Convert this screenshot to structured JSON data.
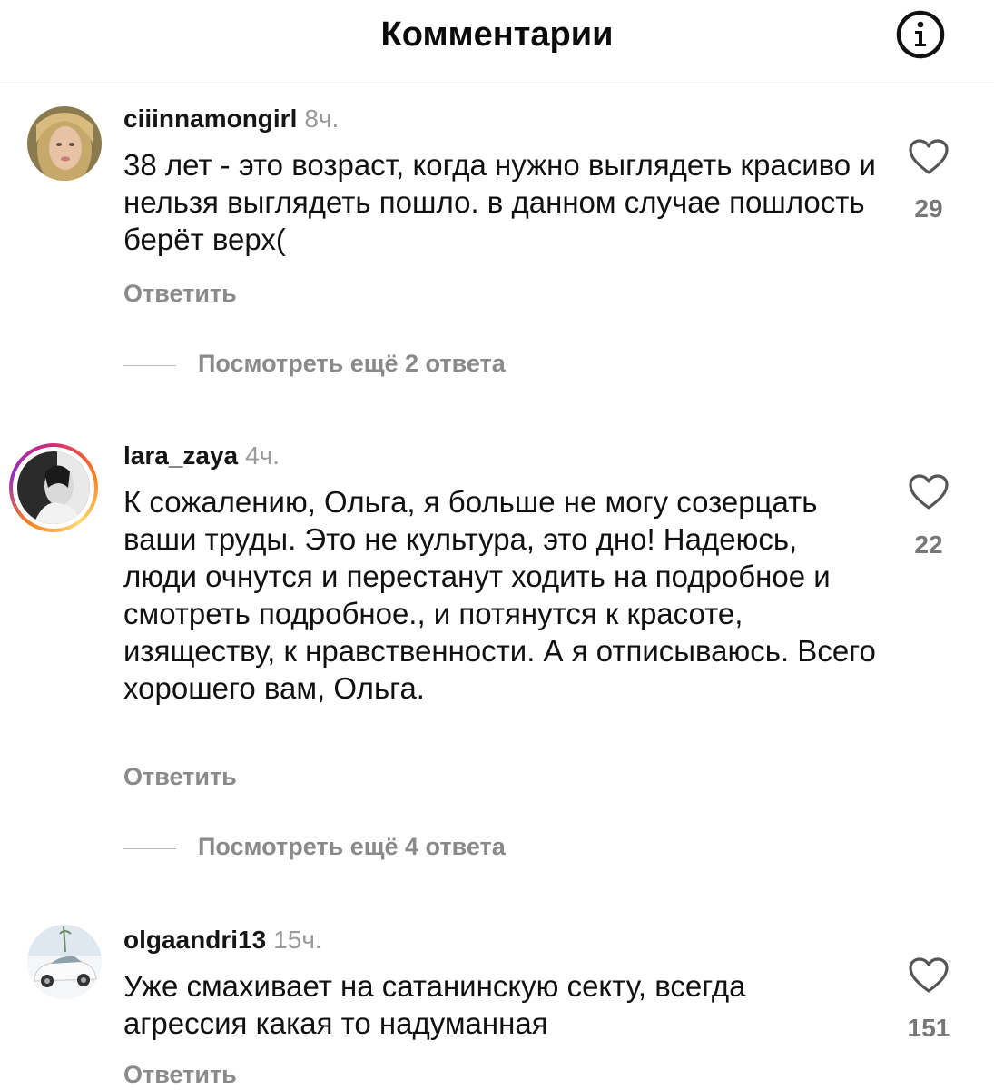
{
  "header": {
    "title": "Комментарии",
    "info_icon": "info-icon"
  },
  "comments": [
    {
      "username": "ciiinnamongirl",
      "time": "8ч.",
      "text": "38 лет - это возраст, когда нужно выглядеть красиво и нельзя выглядеть пошло. в данном случае пошлость берёт верх(",
      "reply_label": "Ответить",
      "likes": "29",
      "view_replies": "Посмотреть ещё 2 ответа",
      "has_story_ring": false
    },
    {
      "username": "lara_zaya",
      "time": "4ч.",
      "text": "К сожалению, Ольга, я больше не могу созерцать ваши труды. Это не культура, это дно! Надеюсь, люди очнутся и перестанут ходить на подробное и смотреть подробное., и потянутся к красоте, изяществу, к нравственности. А я отписываюсь. Всего хорошего вам, Ольга.",
      "reply_label": "Ответить",
      "likes": "22",
      "view_replies": "Посмотреть ещё 4 ответа",
      "has_story_ring": true
    },
    {
      "username": "olgaandri13",
      "time": "15ч.",
      "text": "Уже смахивает на сатанинскую секту, всегда агрессия какая то надуманная",
      "reply_label": "Ответить",
      "likes": "151",
      "has_story_ring": false
    }
  ],
  "icons": {
    "like": "heart-icon",
    "info": "info-icon"
  },
  "colors": {
    "username": "#151515",
    "secondary": "#8a8a8a",
    "timestamp": "#9a9a9a",
    "story_ring_start": "#d62976",
    "story_ring_end": "#fa7e1e"
  }
}
